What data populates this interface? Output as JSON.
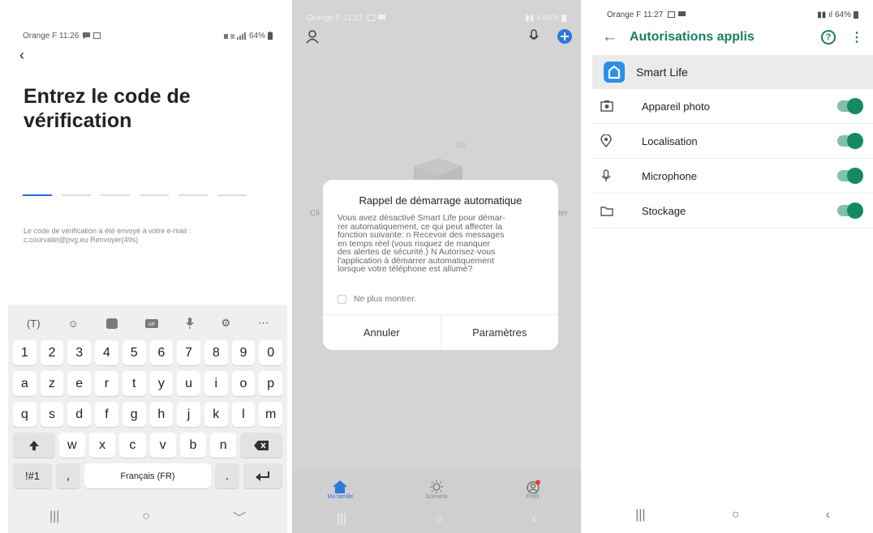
{
  "phone1": {
    "status": {
      "carrier_time": "Orange F 11:26",
      "battery": "64%"
    },
    "title": "Entrez le code de vérification",
    "info_line1": "Le code de vérification a été envoyé à votre e-mail :",
    "info_line2": "c.courvalet@pvg.eu  Renvoyer(49s)",
    "keyboard": {
      "toolbar": [
        "(T)",
        "emoji",
        "sticker",
        "GIF",
        "mic",
        "settings",
        "more"
      ],
      "row_numbers": [
        "1",
        "2",
        "3",
        "4",
        "5",
        "6",
        "7",
        "8",
        "9",
        "0"
      ],
      "row1": [
        "a",
        "z",
        "e",
        "r",
        "t",
        "y",
        "u",
        "i",
        "o",
        "p"
      ],
      "row2": [
        "q",
        "s",
        "d",
        "f",
        "g",
        "h",
        "j",
        "k",
        "l",
        "m"
      ],
      "row3": [
        "w",
        "x",
        "c",
        "v",
        "b",
        "n"
      ],
      "symbols_key": "!#1",
      "comma_key": ",",
      "space_label": "Français (FR)",
      "period_key": "."
    }
  },
  "phone2": {
    "status": {
      "carrier_time": "Orange F 11:27",
      "battery": "64%"
    },
    "bg_left_text": "Cli",
    "bg_right_text": "ter",
    "dialog": {
      "title": "Rappel de démarrage automatique",
      "body_lines": [
        "Vous avez désactivé Smart Life pour démar-",
        "rer automatiquement, ce qui peut affecter la",
        "fonction suivante:  n Recevoir des messages",
        "en temps réel (vous risquez de manquer",
        "des alertes de sécurité.)  N Autorisez-vous",
        "l'application à démarrer automatiquement",
        "lorsque votre téléphone est allumé?"
      ],
      "checkbox_label": "Ne plus montrer.",
      "cancel": "Annuler",
      "settings": "Paramètres"
    },
    "tabs": [
      {
        "label": "Ma famille",
        "icon": "home-icon"
      },
      {
        "label": "Scénario",
        "icon": "sun-icon"
      },
      {
        "label": "Profil",
        "icon": "profile-icon"
      }
    ],
    "accent_color": "#2d79d8"
  },
  "phone3": {
    "status": {
      "carrier_time": "Orange F 11:27",
      "battery": "64%"
    },
    "title": "Autorisations applis",
    "app_name": "Smart Life",
    "permissions": [
      {
        "label": "Appareil photo",
        "icon": "camera-icon",
        "enabled": true
      },
      {
        "label": "Localisation",
        "icon": "location-icon",
        "enabled": true
      },
      {
        "label": "Microphone",
        "icon": "microphone-icon",
        "enabled": true
      },
      {
        "label": "Stockage",
        "icon": "folder-icon",
        "enabled": true
      }
    ],
    "accent_color": "#1d7c63",
    "toggle_color": "#158a62"
  }
}
